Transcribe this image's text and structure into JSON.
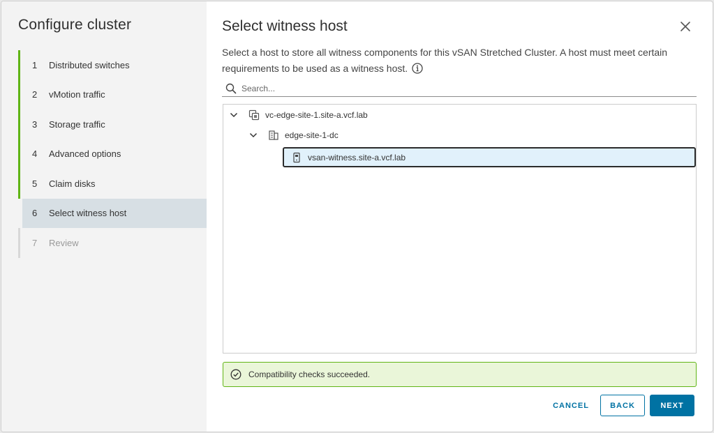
{
  "wizard": {
    "title": "Configure cluster",
    "steps": [
      {
        "num": "1",
        "label": "Distributed switches"
      },
      {
        "num": "2",
        "label": "vMotion traffic"
      },
      {
        "num": "3",
        "label": "Storage traffic"
      },
      {
        "num": "4",
        "label": "Advanced options"
      },
      {
        "num": "5",
        "label": "Claim disks"
      },
      {
        "num": "6",
        "label": "Select witness host"
      },
      {
        "num": "7",
        "label": "Review"
      }
    ]
  },
  "page": {
    "title": "Select witness host",
    "description": "Select a host to store all witness components for this vSAN Stretched Cluster. A host must meet certain requirements to be used as a witness host."
  },
  "search": {
    "placeholder": "Search..."
  },
  "tree": {
    "vcenter": "vc-edge-site-1.site-a.vcf.lab",
    "datacenter": "edge-site-1-dc",
    "host": "vsan-witness.site-a.vcf.lab"
  },
  "alert": {
    "message": "Compatibility checks succeeded."
  },
  "buttons": {
    "cancel": "CANCEL",
    "back": "BACK",
    "next": "NEXT"
  },
  "colors": {
    "accent": "#0072a3",
    "success": "#60b515",
    "selection": "#e1f1fb"
  }
}
